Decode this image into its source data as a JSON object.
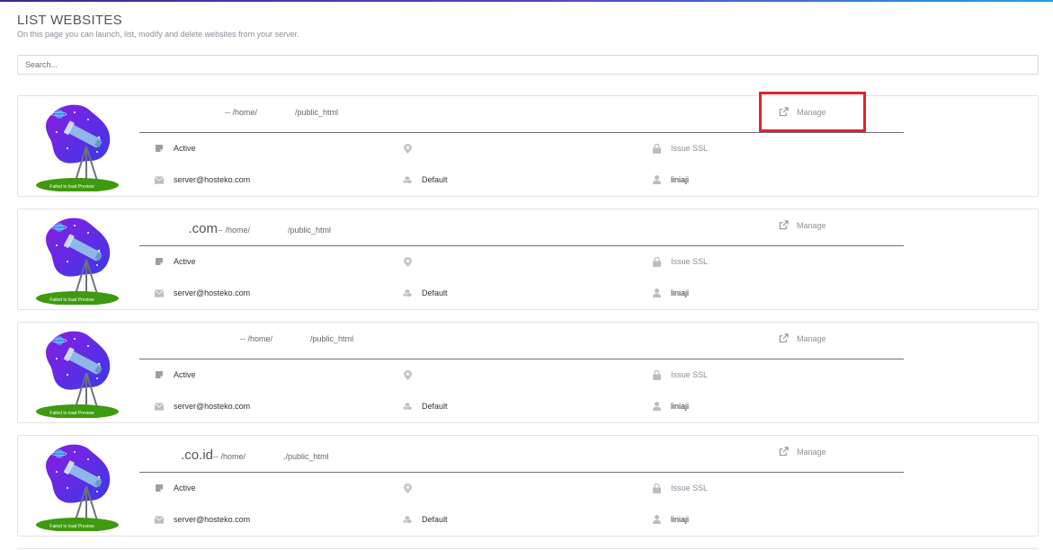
{
  "page": {
    "title": "LIST WEBSITES",
    "subtitle": "On this page you can launch, list, modify and delete websites from your server."
  },
  "search": {
    "placeholder": "Search..."
  },
  "colors": {
    "accent_purple": "#5b3fc4",
    "accent_blue": "#1fa3e0",
    "highlight_red": "#e0232b"
  },
  "preview_label": "Failed to load Preview",
  "websites": [
    {
      "domain": "",
      "path_prefix": " -- /home/",
      "path_suffix": "/public_html",
      "manage_label": "Manage",
      "status": "Active",
      "ip": "",
      "ssl_label": "Issue SSL",
      "email": "server@hosteko.com",
      "package": "Default",
      "owner": "liniaji"
    },
    {
      "domain": ".com",
      "path_prefix": " -- /home/",
      "path_suffix": "/public_html",
      "manage_label": "Manage",
      "status": "Active",
      "ip": "",
      "ssl_label": "Issue SSL",
      "email": "server@hosteko.com",
      "package": "Default",
      "owner": "liniaji"
    },
    {
      "domain": "",
      "path_prefix": " -- /home/",
      "path_suffix": "/public_html",
      "manage_label": "Manage",
      "status": "Active",
      "ip": "",
      "ssl_label": "Issue SSL",
      "email": "server@hosteko.com",
      "package": "Default",
      "owner": "liniaji"
    },
    {
      "domain": ".co.id",
      "path_prefix": " -- /home/",
      "path_suffix": "./public_html",
      "manage_label": "Manage",
      "status": "Active",
      "ip": "",
      "ssl_label": "Issue SSL",
      "email": "server@hosteko.com",
      "package": "Default",
      "owner": "liniaji"
    }
  ]
}
